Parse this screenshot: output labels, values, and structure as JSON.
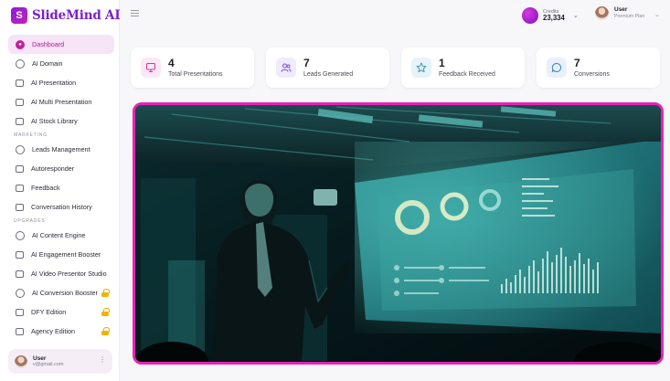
{
  "app": {
    "logo_letter": "S",
    "logo_text": "SlideMind AI"
  },
  "sidebar": {
    "main_items": [
      {
        "label": "Dashboard",
        "icon": "dashboard-icon",
        "active": true
      },
      {
        "label": "AI Domain",
        "icon": "globe-icon"
      },
      {
        "label": "AI Presentation",
        "icon": "presentation-icon"
      },
      {
        "label": "AI Multi Presentation",
        "icon": "multi-presentation-icon"
      },
      {
        "label": "AI Stock Library",
        "icon": "library-icon"
      }
    ],
    "marketing_label": "MARKETING",
    "marketing_items": [
      {
        "label": "Leads Management",
        "icon": "users-icon"
      },
      {
        "label": "Autoresponder",
        "icon": "mail-icon"
      },
      {
        "label": "Feedback",
        "icon": "feedback-icon"
      },
      {
        "label": "Conversation History",
        "icon": "chat-icon"
      }
    ],
    "upgrades_label": "UPGRADES",
    "upgrade_items": [
      {
        "label": "AI Content Engine",
        "icon": "engine-icon",
        "locked": false
      },
      {
        "label": "AI Engagement Booster",
        "icon": "booster-icon",
        "locked": false
      },
      {
        "label": "AI Video Presentor Studio",
        "icon": "video-icon",
        "locked": false
      },
      {
        "label": "AI Conversion Booster",
        "icon": "conversion-icon",
        "locked": true
      },
      {
        "label": "DFY Edition",
        "icon": "dfy-icon",
        "locked": true
      },
      {
        "label": "Agency Edition",
        "icon": "agency-icon",
        "locked": true
      }
    ],
    "user": {
      "name": "User",
      "email": "v@gmail.com"
    }
  },
  "header": {
    "credits_label": "Credits",
    "credits_value": "23,334",
    "user_name": "User",
    "user_plan": "Premium Plan"
  },
  "stats": [
    {
      "value": "4",
      "label": "Total Presentations",
      "icon": "presentation-board-icon",
      "tint": "#fce8f5",
      "stroke": "#d6339f"
    },
    {
      "value": "7",
      "label": "Leads Generated",
      "icon": "users-icon",
      "tint": "#f0eafc",
      "stroke": "#7a4bd8"
    },
    {
      "value": "1",
      "label": "Feedback Received",
      "icon": "star-icon",
      "tint": "#e6f3f8",
      "stroke": "#2f8db3"
    },
    {
      "value": "7",
      "label": "Conversions",
      "icon": "chat-bubble-icon",
      "tint": "#e8f1fb",
      "stroke": "#3a7fc6"
    }
  ],
  "colors": {
    "accent": "#c4219f",
    "hero_border": "#e623b7",
    "brand": "#7a1fd0"
  }
}
